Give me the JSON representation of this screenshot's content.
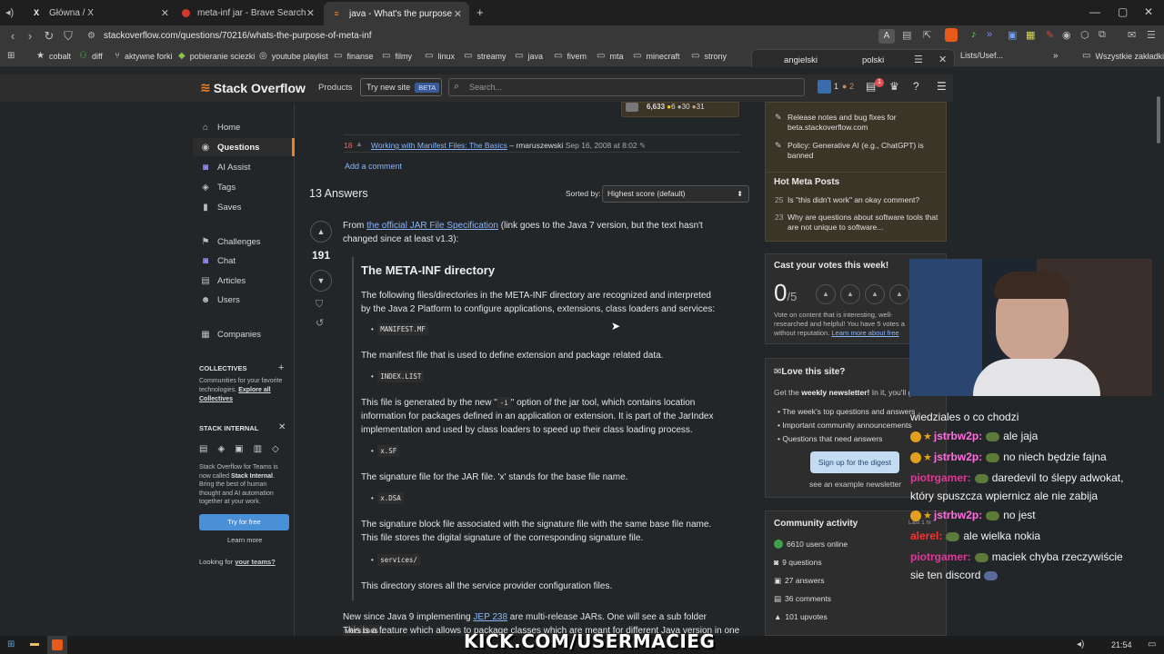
{
  "tabs": [
    {
      "label": "Główna / X",
      "icon": "x-logo-icon"
    },
    {
      "label": "meta-inf jar - Brave Search",
      "icon": "brave-search-icon"
    },
    {
      "label": "java - What's the purpose of ME",
      "icon": "stack-overflow-icon"
    }
  ],
  "new_tab": "+",
  "window_controls": {
    "minimize": "—",
    "maximize": "▢",
    "close": "✕"
  },
  "address": {
    "url": "stackoverflow.com/questions/70216/whats-the-purpose-of-meta-inf"
  },
  "bookmarks": [
    "cobalt",
    "diff",
    "aktywne forki",
    "pobieranie sciezki",
    "youtube playlist",
    "finanse",
    "filmy",
    "linux",
    "streamy",
    "java",
    "fivem",
    "mta",
    "minecraft",
    "strony"
  ],
  "bookmarks_right": "Lists/Usef...",
  "bookmarks_all": "Wszystkie zakładki",
  "translate_popup": {
    "tab_a": "angielski",
    "tab_b": "polski"
  },
  "so": {
    "logo": "Stack Overflow",
    "products": "Products",
    "try_new": "Try new site",
    "beta": "BETA",
    "search_placeholder": "Search...",
    "rep": "1",
    "bronze": "2",
    "inbox": "1"
  },
  "sidenav": {
    "items": [
      "Home",
      "Questions",
      "AI Assist",
      "Tags",
      "Saves",
      "Challenges",
      "Chat",
      "Articles",
      "Users",
      "Companies"
    ],
    "collectives_title": "COLLECTIVES",
    "collectives_text": "Communities for your favorite technologies.",
    "collectives_link": "Explore all Collectives",
    "internal_title": "STACK INTERNAL",
    "internal_text_a": "Stack Overflow for Teams is now called ",
    "internal_bold": "Stack Internal",
    "internal_text_b": ". Bring the best of human thought and AI automation together at your work.",
    "try_free": "Try for free",
    "learn_more": "Learn more",
    "looking": "Looking for ",
    "your_teams": "your teams?"
  },
  "question": {
    "user_rep": "6,633",
    "gold": "6",
    "silver": "30",
    "bronze": "31",
    "comment_votes": "18",
    "comment_link": "Working with Manifest Files: The Basics",
    "comment_author": "– rmaruszewski",
    "comment_date": "Sep 16, 2008 at 8:02",
    "add_comment": "Add a comment"
  },
  "answers": {
    "count": "13 Answers",
    "sorted_by": "Sorted by:",
    "sort_value": "Highest score (default)",
    "score": "191",
    "intro_a": "From ",
    "intro_link": "the official JAR File Specification",
    "intro_b": " (link goes to the Java 7 version, but the text hasn't changed since at least v1.3):",
    "h": "The META-INF directory",
    "p1": "The following files/directories in the META-INF directory are recognized and interpreted by the Java 2 Platform to configure applications, extensions, class loaders and services:",
    "c1": "MANIFEST.MF",
    "p2": "The manifest file that is used to define extension and package related data.",
    "c2": "INDEX.LIST",
    "p3a": "This file is generated by the new \"",
    "p3code": "-i",
    "p3b": "\" option of the jar tool, which contains location information for packages defined in an application or extension. It is part of the JarIndex implementation and used by class loaders to speed up their class loading process.",
    "c3": "x.SF",
    "p4": "The signature file for the JAR file. 'x' stands for the base file name.",
    "c4": "x.DSA",
    "p5": "The signature block file associated with the signature file with the same base file name. This file stores the digital signature of the corresponding signature file.",
    "c5": "services/",
    "p6": "This directory stores all the service provider configuration files.",
    "p7a": "New since Java 9 implementing ",
    "p7link": "JEP 238",
    "p7b": " are multi-release JARs. One will see a sub folder ",
    "p7code": "versions",
    "p7c": ".",
    "p8": "This is a feature which allows to package classes which are meant for different Java version in one"
  },
  "sidebar": {
    "blog1": "Release notes and bug fixes for beta.stackoverflow.com",
    "blog2": "Policy: Generative AI (e.g., ChatGPT) is banned",
    "hot_title": "Hot Meta Posts",
    "hot": [
      {
        "n": "25",
        "t": "Is \"this didn't work\" an okay comment?"
      },
      {
        "n": "23",
        "t": "Why are questions about software tools that are not unique to software..."
      }
    ],
    "votes_title": "Cast your votes this week!",
    "votes_num": "0",
    "votes_den": "/5",
    "votes_text": "Vote on content that is interesting, well-researched and helpful! You have 5 votes a",
    "votes_text2": "without reputation. ",
    "votes_link": "Learn more about free",
    "love_title": "Love this site?",
    "love_text_a": "Get the ",
    "love_bold": "weekly newsletter!",
    "love_text_b": " In it, you'll get:",
    "love_items": [
      "The week's top questions and answers",
      "Important community announcements",
      "Questions that need answers"
    ],
    "signup": "Sign up for the digest",
    "example": "see an example newsletter",
    "activity_title": "Community activity",
    "activity": [
      "6610 users online",
      "9 questions",
      "27 answers",
      "36 comments",
      "101 upvotes"
    ]
  },
  "stream": {
    "chat": [
      {
        "user": "",
        "msg": "wiedziales o co chodzi",
        "color": "#ffffff"
      },
      {
        "user": "jstrbw2p:",
        "msg": "ale jaja",
        "color": "#ff6fe0",
        "badges": true
      },
      {
        "user": "jstrbw2p:",
        "msg": "no niech będzie fajna",
        "color": "#ff6fe0",
        "badges": true
      },
      {
        "user": "piotrgamer:",
        "msg": "daredevil to ślepy adwokat,",
        "color": "#e0389a"
      },
      {
        "user": "",
        "msg": "który spuszcza wpiernicz ale nie zabija",
        "color": "#ffffff"
      },
      {
        "user": "jstrbw2p:",
        "msg": "no jest",
        "color": "#ff6fe0",
        "badges": true
      },
      {
        "user": "alerel:",
        "msg": "ale wielka nokia",
        "color": "#ff3030"
      },
      {
        "user": "piotrgamer:",
        "msg": "maciek chyba rzeczywiście",
        "color": "#e0389a"
      },
      {
        "user": "",
        "msg": "sie ten discord",
        "color": "#ffffff"
      }
    ],
    "overlay": "KICK.COM/USERMACIEG",
    "timestamp_small": "Last 1 hr"
  },
  "taskbar": {
    "time": "21:54"
  },
  "colors": {
    "accent": "#f48024",
    "link": "#8ab4f8",
    "kick": "#53fc18"
  }
}
